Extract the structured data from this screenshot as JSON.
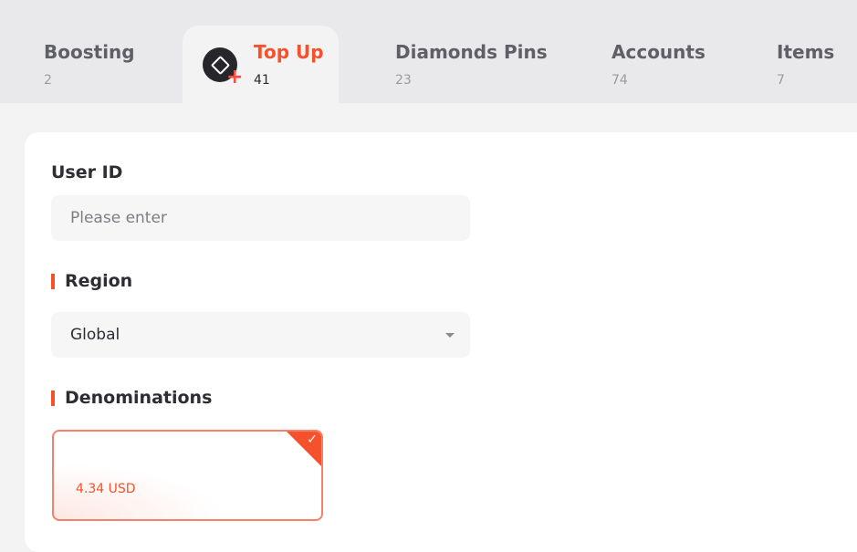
{
  "tabs": [
    {
      "label": "Boosting",
      "count": "2"
    },
    {
      "label": "Top Up",
      "count": "41"
    },
    {
      "label": "Diamonds Pins",
      "count": "23"
    },
    {
      "label": "Accounts",
      "count": "74"
    },
    {
      "label": "Items",
      "count": "7"
    }
  ],
  "active_tab_icon": "game-diamond-plus-icon",
  "form": {
    "user_id": {
      "label": "User ID",
      "placeholder": "Please enter",
      "value": ""
    },
    "region": {
      "label": "Region",
      "selected": "Global"
    },
    "denominations": {
      "label": "Denominations",
      "items": [
        {
          "price": "4.34 USD",
          "selected": true
        }
      ]
    }
  },
  "colors": {
    "accent": "#f4512c",
    "tab_bg": "#e9e9eb",
    "page_bg": "#f3f3f4"
  }
}
